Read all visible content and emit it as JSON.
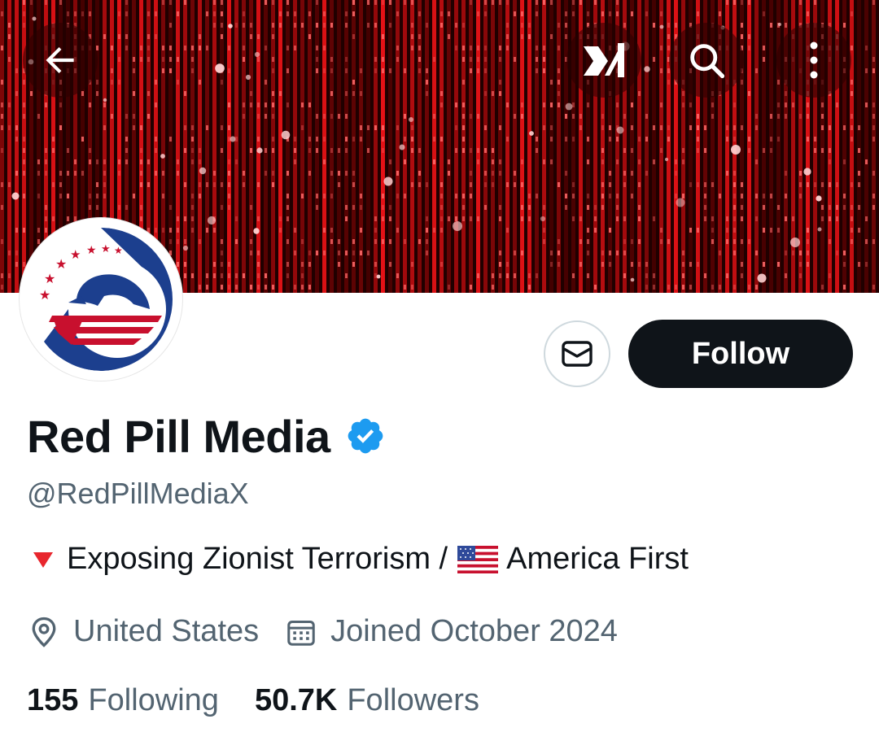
{
  "header": {
    "back_icon": "arrow-left-icon",
    "grok_icon": "grok-icon",
    "search_icon": "search-icon",
    "more_icon": "more-vertical-icon",
    "banner_description": "red matrix code rain"
  },
  "profile": {
    "name": "Red Pill Media",
    "verified": true,
    "handle": "@RedPillMediaX",
    "bio": {
      "prefix_icon": "red-triangle-icon",
      "part1": "Exposing Zionist Terrorism /",
      "flag_icon": "us-flag-icon",
      "part2": "America First"
    },
    "location": "United States",
    "joined": "Joined October 2024",
    "following_count": "155",
    "following_label": "Following",
    "followers_count": "50.7K",
    "followers_label": "Followers"
  },
  "actions": {
    "message_icon": "envelope-icon",
    "follow_label": "Follow"
  },
  "colors": {
    "text_primary": "#0f1419",
    "text_secondary": "#536471",
    "verified_blue": "#1d9bf0",
    "button_dark": "#0f1419",
    "banner_red": "#e0101a"
  }
}
